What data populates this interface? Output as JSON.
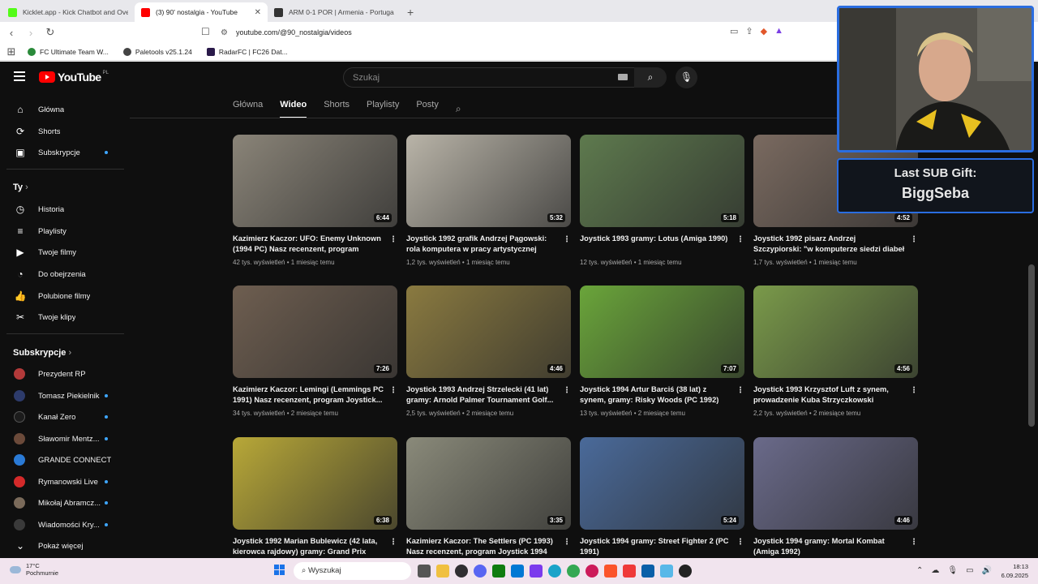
{
  "browser": {
    "tabs": [
      {
        "title": "Kicklet.app - Kick Chatbot and Overlay",
        "color": "#53fc18"
      },
      {
        "title": "(3) 90' nostalgia - YouTube",
        "color": "#ff0000",
        "active": true
      },
      {
        "title": "ARM 0-1 POR | Armenia - Portugalia",
        "color": "#333333"
      }
    ],
    "url": "youtube.com/@90_nostalgia/videos",
    "bookmarks": [
      "FC Ultimate Team W...",
      "Paletools v25.1.24",
      "RadarFC | FC26 Dat..."
    ]
  },
  "youtube": {
    "logo": "YouTube",
    "country": "PL",
    "search_placeholder": "Szukaj",
    "sidebar": {
      "main": [
        {
          "label": "Główna",
          "icon": "home-icon"
        },
        {
          "label": "Shorts",
          "icon": "shorts-icon"
        },
        {
          "label": "Subskrypcje",
          "icon": "subscriptions-icon",
          "dot": true
        }
      ],
      "you_header": "Ty",
      "you": [
        {
          "label": "Historia",
          "icon": "history-icon"
        },
        {
          "label": "Playlisty",
          "icon": "playlists-icon"
        },
        {
          "label": "Twoje filmy",
          "icon": "your-videos-icon"
        },
        {
          "label": "Do obejrzenia",
          "icon": "watch-later-icon"
        },
        {
          "label": "Polubione filmy",
          "icon": "liked-icon"
        },
        {
          "label": "Twoje klipy",
          "icon": "clips-icon"
        }
      ],
      "subs_header": "Subskrypcje",
      "subs": [
        {
          "label": "Prezydent RP",
          "color": "#b33a3a",
          "dot": false
        },
        {
          "label": "Tomasz Piekielnik",
          "color": "#2d3b6b",
          "dot": true
        },
        {
          "label": "Kanał Zero",
          "color": "#1c1c1c",
          "dot": true
        },
        {
          "label": "Sławomir Mentz...",
          "color": "#6b4a3a",
          "dot": true
        },
        {
          "label": "GRANDE CONNECT...",
          "color": "#2a7ad5",
          "dot": false
        },
        {
          "label": "Rymanowski Live",
          "color": "#d42a2a",
          "dot": true
        },
        {
          "label": "Mikołaj Abramcz...",
          "color": "#7a6a5a",
          "dot": true
        },
        {
          "label": "Wiadomości Kry...",
          "color": "#3a3a3a",
          "dot": true
        }
      ],
      "more": "Pokaż więcej"
    },
    "channel_tabs": [
      "Główna",
      "Wideo",
      "Shorts",
      "Playlisty",
      "Posty"
    ],
    "active_tab": "Wideo",
    "videos": [
      {
        "title": "Kazimierz Kaczor: UFO: Enemy Unknown (1994 PC) Nasz recenzent, program Joysti...",
        "meta": "42 tys. wyświetleń • 1 miesiąc temu",
        "duration": "6:44",
        "color": "#8a8478"
      },
      {
        "title": "Joystick 1992 grafik Andrzej Pągowski: rola komputera w pracy artystycznej",
        "meta": "1,2 tys. wyświetleń • 1 miesiąc temu",
        "duration": "5:32",
        "color": "#b9b4a8"
      },
      {
        "title": "Joystick 1993 gramy: Lotus (Amiga 1990)",
        "meta": "12 tys. wyświetleń • 1 miesiąc temu",
        "duration": "5:18",
        "color": "#5e7a4e"
      },
      {
        "title": "Joystick 1992 pisarz Andrzej Szczypiorski: \"w komputerze siedzi diabeł i komputer nie...",
        "meta": "1,7 tys. wyświetleń • 1 miesiąc temu",
        "duration": "4:52",
        "color": "#7a6a60"
      },
      {
        "title": "Kazimierz Kaczor: Lemingi (Lemmings PC 1991) Nasz recenzent, program Joystick...",
        "meta": "34 tys. wyświetleń • 2 miesiące temu",
        "duration": "7:26",
        "color": "#6e5e50"
      },
      {
        "title": "Joystick 1993 Andrzej Strzelecki (41 lat) gramy: Arnold Palmer Tournament Golf...",
        "meta": "2,5 tys. wyświetleń • 2 miesiące temu",
        "duration": "4:46",
        "color": "#8a7a40"
      },
      {
        "title": "Joystick 1994 Artur Barciś (38 lat) z synem, gramy: Risky Woods (PC 1992) prowadzeni...",
        "meta": "13 tys. wyświetleń • 2 miesiące temu",
        "duration": "7:07",
        "color": "#6aa53a"
      },
      {
        "title": "Joystick 1993 Krzysztof Luft z synem, prowadzenie Kuba Strzyczkowski gramy:...",
        "meta": "2,2 tys. wyświetleń • 2 miesiące temu",
        "duration": "4:56",
        "color": "#7a9a4a"
      },
      {
        "title": "Joystick 1992 Marian Bublewicz (42 lata, kierowca rajdowy) gramy: Grand Prix Circui...",
        "meta": "",
        "duration": "6:38",
        "color": "#b8a838"
      },
      {
        "title": "Kazimierz Kaczor: The Settlers (PC 1993) Nasz recenzent, program Joystick 1994",
        "meta": "",
        "duration": "3:35",
        "color": "#8a8a7a"
      },
      {
        "title": "Joystick 1994 gramy: Street Fighter 2 (PC 1991)",
        "meta": "",
        "duration": "5:24",
        "color": "#4a6a9a"
      },
      {
        "title": "Joystick 1994 gramy: Mortal Kombat (Amiga 1992)",
        "meta": "",
        "duration": "4:46",
        "color": "#6a6a8a"
      }
    ]
  },
  "overlay": {
    "sub_line1": "Last SUB Gift:",
    "sub_line2": "BiggSeba"
  },
  "taskbar": {
    "temp": "17°C",
    "weather": "Pochmurnie",
    "search": "Wyszukaj",
    "time": "18:13",
    "date": "6.09.2025"
  }
}
